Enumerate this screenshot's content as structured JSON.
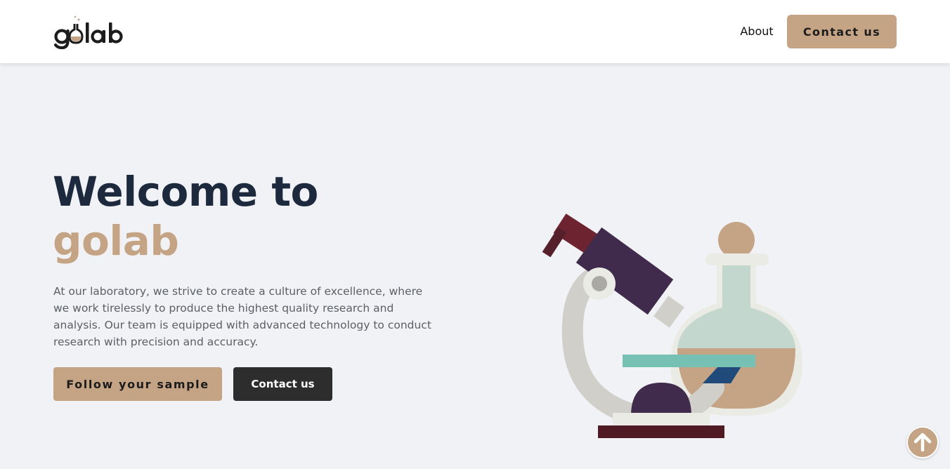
{
  "header": {
    "logo_text": "golab",
    "nav": {
      "about_label": "About",
      "contact_label": "Contact us"
    }
  },
  "hero": {
    "title_line1": "Welcome to",
    "title_line2": "golab",
    "description": "At our laboratory, we strive to create a culture of excellence, where we work tirelessly to produce the highest quality research and analysis. Our team is equipped with advanced technology to conduct research with precision and accuracy.",
    "buttons": {
      "follow_label": "Follow your sample",
      "contact_label": "Contact us"
    }
  },
  "icons": {
    "illustration": "microscope-flask-illustration",
    "scroll_top": "arrow-up-icon"
  },
  "colors": {
    "accent": "#c4a484",
    "title": "#1d2a3d",
    "background": "#f1f2f6",
    "dark_button": "#2d2d2d"
  }
}
